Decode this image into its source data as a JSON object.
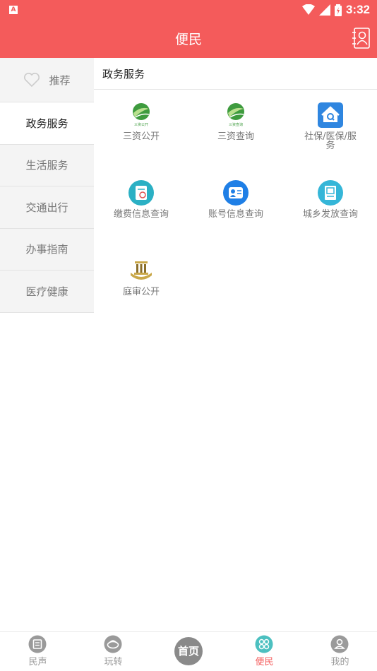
{
  "status_bar": {
    "time": "3:32",
    "notification_badge": "A"
  },
  "header": {
    "title": "便民",
    "contacts_icon": "contacts-icon"
  },
  "sidebar": {
    "items": [
      {
        "label": "推荐",
        "icon": "heart-icon"
      },
      {
        "label": "政务服务"
      },
      {
        "label": "生活服务"
      },
      {
        "label": "交通出行"
      },
      {
        "label": "办事指南"
      },
      {
        "label": "医疗健康"
      }
    ],
    "active_index": 1
  },
  "content": {
    "section_title": "政务服务",
    "services": [
      {
        "label": "三资公开",
        "icon_text": "三资公开"
      },
      {
        "label": "三资查询",
        "icon_text": "三资查询"
      },
      {
        "label": "社保/医保/服务"
      },
      {
        "label": "缴费信息查询"
      },
      {
        "label": "账号信息查询"
      },
      {
        "label": "城乡发放查询"
      },
      {
        "label": "庭审公开"
      }
    ]
  },
  "bottom_nav": {
    "items": [
      {
        "label": "民声"
      },
      {
        "label": "玩转"
      },
      {
        "label": "首页"
      },
      {
        "label": "便民"
      },
      {
        "label": "我的"
      }
    ],
    "home_glyph": "首页"
  },
  "colors": {
    "brand": "#f45b5b",
    "inactive": "#999999",
    "active": "#f45b5b"
  }
}
